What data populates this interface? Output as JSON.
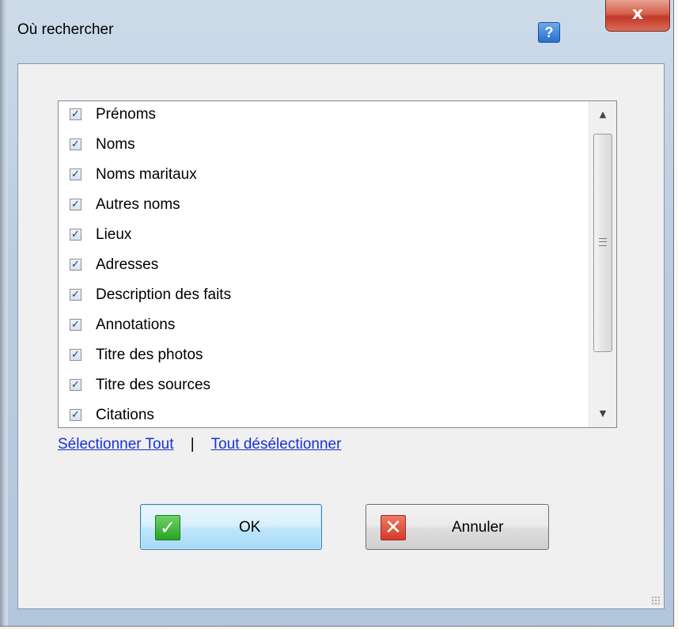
{
  "window": {
    "title": "Où rechercher",
    "help_label": "?",
    "close_label": "x"
  },
  "list": {
    "items": [
      {
        "label": "Prénoms",
        "checked": true
      },
      {
        "label": "Noms",
        "checked": true
      },
      {
        "label": "Noms maritaux",
        "checked": true
      },
      {
        "label": "Autres noms",
        "checked": true
      },
      {
        "label": "Lieux",
        "checked": true
      },
      {
        "label": "Adresses",
        "checked": true
      },
      {
        "label": "Description des faits",
        "checked": true
      },
      {
        "label": "Annotations",
        "checked": true
      },
      {
        "label": "Titre des photos",
        "checked": true
      },
      {
        "label": "Titre des sources",
        "checked": true
      },
      {
        "label": "Citations",
        "checked": true
      }
    ],
    "check_glyph": "✓",
    "scroll_up_glyph": "▲",
    "scroll_down_glyph": "▼"
  },
  "links": {
    "select_all": "Sélectionner Tout",
    "separator": "|",
    "deselect_all": "Tout désélectionner"
  },
  "buttons": {
    "ok_label": "OK",
    "ok_icon": "✓",
    "cancel_label": "Annuler",
    "cancel_icon": "✕"
  },
  "colors": {
    "link": "#1632d6",
    "ok_icon": "#27a524",
    "cancel_icon": "#d6392a",
    "title_bar": "#cddbe9"
  }
}
